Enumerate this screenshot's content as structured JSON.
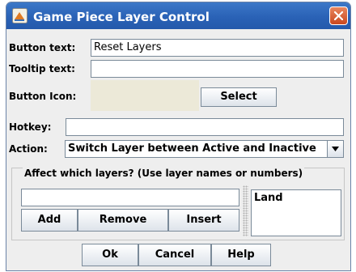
{
  "window": {
    "title": "Game Piece Layer Control"
  },
  "fields": {
    "button_text_label": "Button text:",
    "button_text_value": "Reset Layers",
    "tooltip_label": "Tooltip text:",
    "tooltip_value": "",
    "icon_label": "Button Icon:",
    "select_label": "Select",
    "hotkey_label": "Hotkey:",
    "hotkey_value": "",
    "action_label": "Action:",
    "action_value": "Switch Layer between Active and Inactive"
  },
  "layers": {
    "group_title": "Affect which layers? (Use layer names or numbers)",
    "entry_value": "",
    "add_label": "Add",
    "remove_label": "Remove",
    "insert_label": "Insert",
    "items": [
      "Land"
    ]
  },
  "footer": {
    "ok_label": "Ok",
    "cancel_label": "Cancel",
    "help_label": "Help"
  },
  "icons": {
    "app": "app-icon",
    "close": "close-icon",
    "dropdown": "chevron-down-icon"
  },
  "colors": {
    "titlebar": "#2a62b6",
    "close": "#d65a30",
    "panel": "#eeeeee",
    "icon_well": "#ece9d8"
  }
}
